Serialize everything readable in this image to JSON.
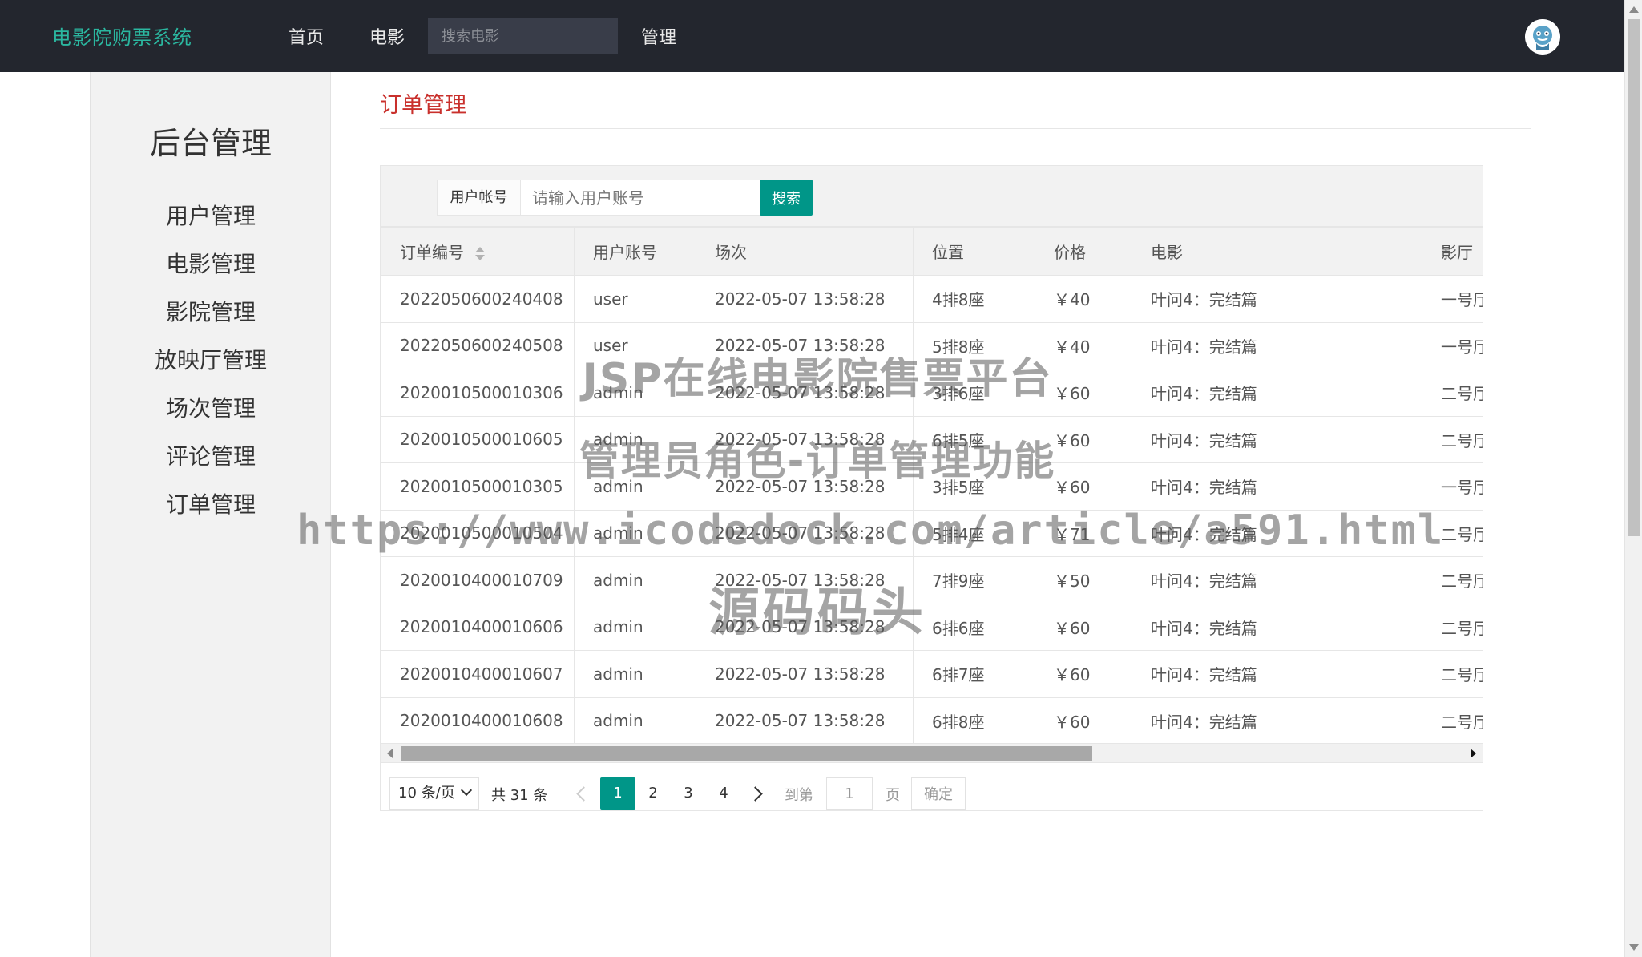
{
  "app": {
    "brand": "电影院购票系统",
    "nav": [
      "首页",
      "电影",
      "管理"
    ],
    "search_placeholder": "搜索电影"
  },
  "sidebar": {
    "title": "后台管理",
    "items": [
      "用户管理",
      "电影管理",
      "影院管理",
      "放映厅管理",
      "场次管理",
      "评论管理",
      "订单管理"
    ]
  },
  "page": {
    "title": "订单管理",
    "filter_label": "用户帐号",
    "filter_placeholder": "请输入用户账号",
    "search_button": "搜索"
  },
  "table": {
    "columns": [
      "订单编号",
      "用户账号",
      "场次",
      "位置",
      "价格",
      "电影",
      "影厅"
    ],
    "rows": [
      [
        "2022050600240408",
        "user",
        "2022-05-07 13:58:28",
        "4排8座",
        "￥40",
        "叶问4：完结篇",
        "一号厅"
      ],
      [
        "2022050600240508",
        "user",
        "2022-05-07 13:58:28",
        "5排8座",
        "￥40",
        "叶问4：完结篇",
        "一号厅"
      ],
      [
        "2020010500010306",
        "admin",
        "2022-05-07 13:58:28",
        "3排6座",
        "￥60",
        "叶问4：完结篇",
        "二号厅"
      ],
      [
        "2020010500010605",
        "admin",
        "2022-05-07 13:58:28",
        "6排5座",
        "￥60",
        "叶问4：完结篇",
        "二号厅"
      ],
      [
        "2020010500010305",
        "admin",
        "2022-05-07 13:58:28",
        "3排5座",
        "￥60",
        "叶问4：完结篇",
        "一号厅"
      ],
      [
        "2020010500010504",
        "admin",
        "2022-05-07 13:58:28",
        "5排4座",
        "￥71",
        "叶问4：完结篇",
        "二号厅"
      ],
      [
        "2020010400010709",
        "admin",
        "2022-05-07 13:58:28",
        "7排9座",
        "￥50",
        "叶问4：完结篇",
        "二号厅"
      ],
      [
        "2020010400010606",
        "admin",
        "2022-05-07 13:58:28",
        "6排6座",
        "￥60",
        "叶问4：完结篇",
        "二号厅"
      ],
      [
        "2020010400010607",
        "admin",
        "2022-05-07 13:58:28",
        "6排7座",
        "￥60",
        "叶问4：完结篇",
        "二号厅"
      ],
      [
        "2020010400010608",
        "admin",
        "2022-05-07 13:58:28",
        "6排8座",
        "￥60",
        "叶问4：完结篇",
        "二号厅"
      ]
    ]
  },
  "pager": {
    "limit": "10 条/页",
    "total": "共 31 条",
    "pages": [
      "1",
      "2",
      "3",
      "4"
    ],
    "current": "1",
    "goto_prefix": "到第",
    "goto_value": "1",
    "goto_suffix": "页",
    "confirm": "确定"
  },
  "watermark": {
    "line1": "JSP在线电影院售票平台",
    "line2": "管理员角色-订单管理功能",
    "line3": "https://www.icodedock.com/article/a591.html",
    "line4": "源码码头"
  },
  "colors": {
    "topbar": "#23262e",
    "brand": "#2bb7a0",
    "accent": "#009688",
    "title": "#c9302c"
  }
}
